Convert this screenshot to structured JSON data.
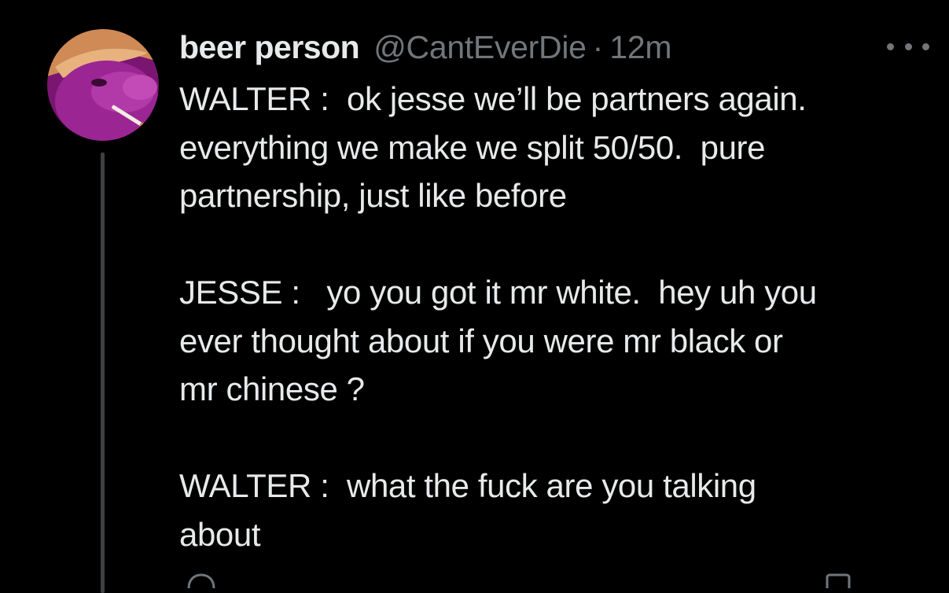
{
  "tweet": {
    "display_name": "beer person",
    "handle": "@CantEverDie",
    "separator": "·",
    "time": "12m",
    "more_icon": "more-horizontal-icon",
    "lines": [
      "WALTER :  ok jesse we’ll be partners again.",
      "everything we make we split 50/50.  pure",
      "partnership, just like before",
      "",
      "JESSE :   yo you got it mr white.  hey uh you",
      "ever thought about if you were mr black or",
      "mr chinese ?",
      "",
      "WALTER :  what the fuck are you talking",
      "about"
    ]
  },
  "colors": {
    "background": "#000000",
    "primary_text": "#e7e9ea",
    "secondary_text": "#71767b",
    "thread_line": "#3e4144",
    "avatar_purple": "#8e1f86",
    "avatar_hat": "#d9a06a"
  },
  "action_icons": [
    "reply-icon",
    "retweet-icon",
    "like-icon",
    "views-icon",
    "share-icon"
  ]
}
